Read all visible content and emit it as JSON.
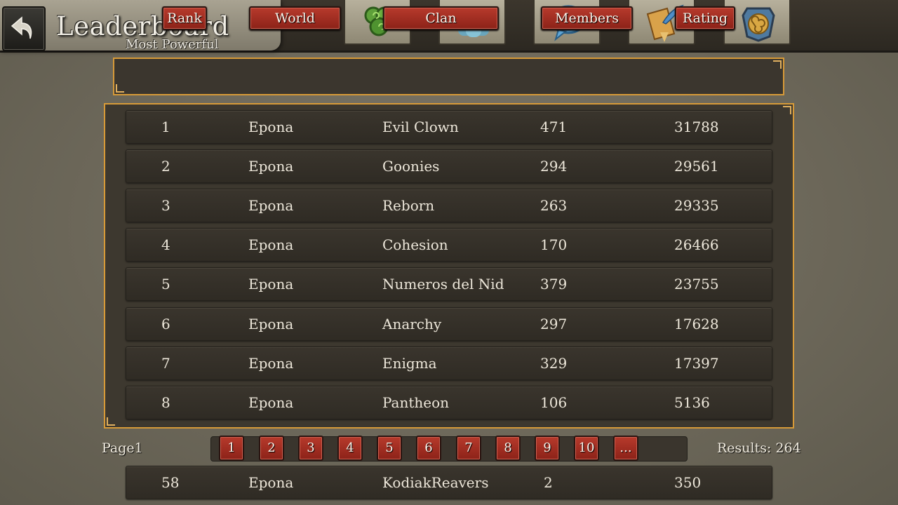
{
  "header": {
    "title": "Leaderboard",
    "subtitle": "Most Powerful",
    "nav_icons": [
      "spiral-icon",
      "group-icon",
      "chat-icon",
      "quill-scroll-icon",
      "shield-emblem-icon"
    ]
  },
  "columns": [
    "Rank",
    "World",
    "Clan",
    "Members",
    "Rating"
  ],
  "rows": [
    {
      "rank": "1",
      "world": "Epona",
      "clan": "Evil Clown",
      "members": "471",
      "rating": "31788"
    },
    {
      "rank": "2",
      "world": "Epona",
      "clan": "Goonies",
      "members": "294",
      "rating": "29561"
    },
    {
      "rank": "3",
      "world": "Epona",
      "clan": "Reborn",
      "members": "263",
      "rating": "29335"
    },
    {
      "rank": "4",
      "world": "Epona",
      "clan": "Cohesion",
      "members": "170",
      "rating": "26466"
    },
    {
      "rank": "5",
      "world": "Epona",
      "clan": "Numeros del Nid",
      "members": "379",
      "rating": "23755"
    },
    {
      "rank": "6",
      "world": "Epona",
      "clan": "Anarchy",
      "members": "297",
      "rating": "17628"
    },
    {
      "rank": "7",
      "world": "Epona",
      "clan": "Enigma",
      "members": "329",
      "rating": "17397"
    },
    {
      "rank": "8",
      "world": "Epona",
      "clan": "Pantheon",
      "members": "106",
      "rating": "5136"
    }
  ],
  "pager": {
    "label": "Page1",
    "pages": [
      "1",
      "2",
      "3",
      "4",
      "5",
      "6",
      "7",
      "8",
      "9",
      "10",
      "..."
    ],
    "results": "Results: 264"
  },
  "own_row": {
    "rank": "58",
    "world": "Epona",
    "clan": "KodiakReavers",
    "members": "2",
    "rating": "350"
  },
  "colors": {
    "accent_red": "#a52e22",
    "frame_gold": "#d79a38",
    "panel": "#3b362e"
  }
}
